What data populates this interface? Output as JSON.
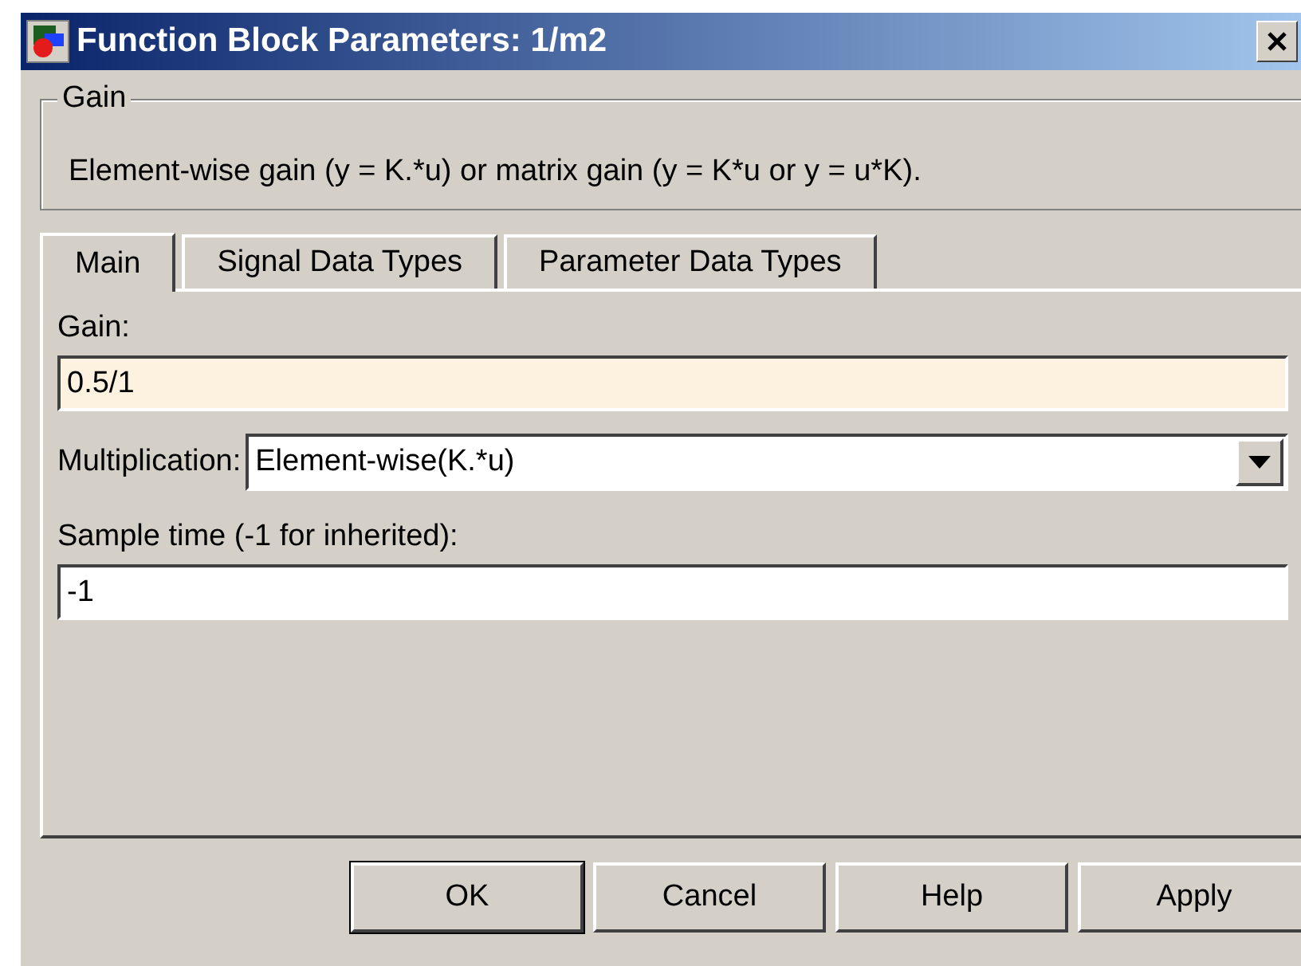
{
  "window": {
    "title": "Function Block Parameters: 1/m2"
  },
  "group": {
    "label": "Gain",
    "description": "Element-wise gain (y = K.*u) or matrix gain (y = K*u or y = u*K)."
  },
  "tabs": [
    {
      "label": "Main",
      "selected": true
    },
    {
      "label": "Signal Data Types",
      "selected": false
    },
    {
      "label": "Parameter Data Types",
      "selected": false
    }
  ],
  "fields": [
    {
      "kind": "text",
      "label": "Gain:",
      "value": "0.5/1",
      "highlighted": true
    },
    {
      "kind": "dropdown",
      "label": "Multiplication:",
      "value": "Element-wise(K.*u)"
    },
    {
      "kind": "text",
      "label": "Sample time (-1 for inherited):",
      "value": "-1",
      "highlighted": false
    }
  ],
  "buttons": [
    {
      "label": "OK",
      "default": true
    },
    {
      "label": "Cancel",
      "default": false
    },
    {
      "label": "Help",
      "default": false
    },
    {
      "label": "Apply",
      "default": false
    }
  ]
}
